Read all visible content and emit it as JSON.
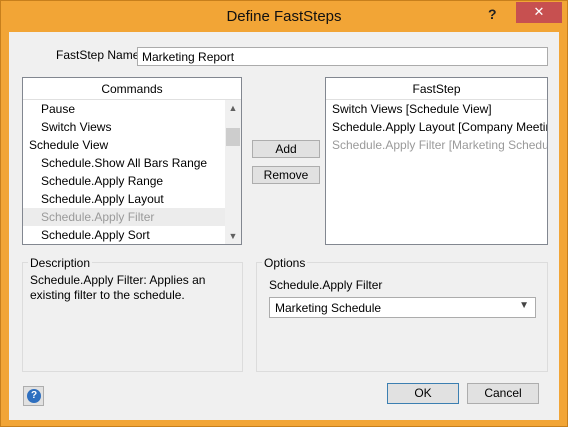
{
  "window": {
    "title": "Define FastSteps",
    "help_glyph": "?",
    "close_glyph": "✕"
  },
  "name_field": {
    "label": "FastStep Name:",
    "value": "Marketing Report"
  },
  "commands": {
    "header": "Commands",
    "items": [
      {
        "label": "Pause",
        "kind": "child"
      },
      {
        "label": "Switch Views",
        "kind": "child"
      },
      {
        "label": "Schedule View",
        "kind": "group"
      },
      {
        "label": "Schedule.Show All Bars Range",
        "kind": "child"
      },
      {
        "label": "Schedule.Apply Range",
        "kind": "child"
      },
      {
        "label": "Schedule.Apply Layout",
        "kind": "child"
      },
      {
        "label": "Schedule.Apply Filter",
        "kind": "child-disabled-selected"
      },
      {
        "label": "Schedule.Apply Sort",
        "kind": "child"
      }
    ],
    "scroll_up": "▲",
    "scroll_down": "▼"
  },
  "buttons": {
    "add": "Add",
    "remove": "Remove",
    "ok": "OK",
    "cancel": "Cancel"
  },
  "faststep": {
    "header": "FastStep",
    "items": [
      {
        "label": "Switch Views [Schedule View]",
        "disabled": false
      },
      {
        "label": "Schedule.Apply Layout [Company Meeting...",
        "disabled": false
      },
      {
        "label": "Schedule.Apply Filter [Marketing Schedule]",
        "disabled": true
      }
    ]
  },
  "description": {
    "title": "Description",
    "text": "Schedule.Apply Filter: Applies an existing filter to the schedule."
  },
  "options": {
    "title": "Options",
    "label": "Schedule.Apply Filter",
    "selected": "Marketing Schedule",
    "chevron": "▼"
  },
  "help_icon_glyph": "?",
  "colors": {
    "title_bar": "#f2a536",
    "close_button": "#c75050",
    "disabled_text": "#9a9a9a"
  }
}
